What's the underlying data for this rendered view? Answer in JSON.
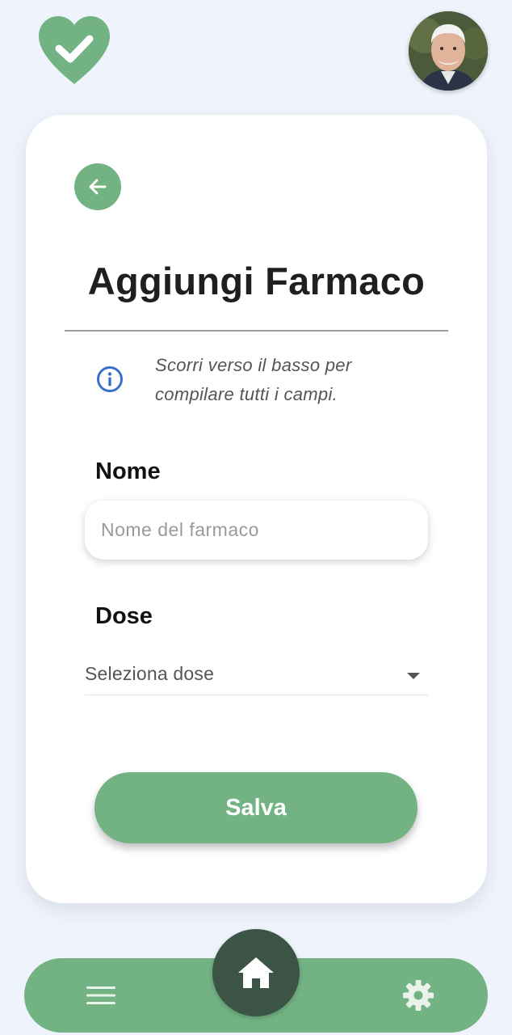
{
  "colors": {
    "accent": "#72b283",
    "home_button": "#3b5446",
    "background": "#eff3fb",
    "info_icon": "#3c6fc8"
  },
  "header": {
    "logo_icon": "heart-check-icon",
    "avatar_icon": "user-avatar"
  },
  "form": {
    "back_icon": "arrow-left-icon",
    "title": "Aggiungi Farmaco",
    "info_icon": "info-icon",
    "info_text": "Scorri verso il basso per compilare tutti i campi.",
    "name_label": "Nome",
    "name_placeholder": "Nome del farmaco",
    "name_value": "",
    "dose_label": "Dose",
    "dose_selected": "Seleziona dose",
    "save_label": "Salva"
  },
  "bottom_nav": {
    "menu_icon": "menu-icon",
    "home_icon": "home-icon",
    "settings_icon": "gear-icon"
  }
}
